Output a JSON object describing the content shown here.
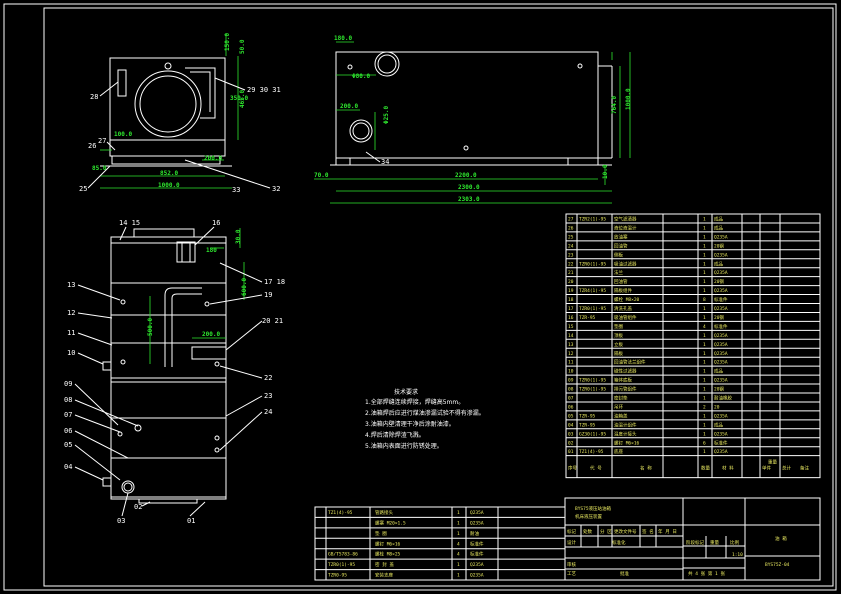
{
  "callouts": {
    "top_left": [
      "28",
      "29 30 31",
      "27",
      "26",
      "25",
      "32",
      "33"
    ],
    "main": [
      "14 15",
      "16",
      "17 18",
      "13",
      "19",
      "12",
      "20 21",
      "11",
      "10",
      "22",
      "09",
      "23",
      "08",
      "07",
      "24",
      "06",
      "05",
      "04",
      "03",
      "02",
      "01"
    ],
    "side": [
      "34"
    ]
  },
  "dimensions": {
    "top_left": [
      "150.0",
      "50.0",
      "465.0",
      "350.0",
      "200.0",
      "100.0",
      "852.0",
      "1000.0",
      "85.0"
    ],
    "side": [
      "180.0",
      "Φ80.0",
      "200.0",
      "Φ25.0",
      "764.0",
      "1000.0",
      "10.0",
      "70.0",
      "2200.0",
      "2300.0",
      "2303.0"
    ],
    "main": [
      "180",
      "30.0",
      "600.0",
      "200.0",
      "500.0"
    ]
  },
  "notes": {
    "title": "技术要求",
    "items": [
      "1.全部焊缝连续焊接，焊缝高5mm。",
      "2.油箱焊后应进行煤油渗漏试验不得有渗漏。",
      "3.油箱内壁清理干净后涂耐油漆。",
      "4.焊后清除焊渣飞溅。",
      "5.油箱内表面进行防锈处理。"
    ]
  },
  "parts_list": {
    "headers": [
      "序号",
      "代 号",
      "名 称",
      "数量",
      "材 料",
      "单件",
      "总计",
      "备注"
    ],
    "header_weight": "重量",
    "rows": [
      [
        "27",
        "TZR2(1)-95",
        "空气滤清器",
        "1",
        "成品",
        ""
      ],
      [
        "26",
        "",
        "液位液温计",
        "1",
        "成品",
        ""
      ],
      [
        "25",
        "",
        "放油塞",
        "1",
        "Q235A",
        ""
      ],
      [
        "24",
        "",
        "回油管",
        "1",
        "20钢",
        ""
      ],
      [
        "23",
        "",
        "侧板",
        "1",
        "Q235A",
        ""
      ],
      [
        "22",
        "TZR0(1)-95",
        "吸油过滤器",
        "1",
        "成品",
        ""
      ],
      [
        "21",
        "",
        "法兰",
        "1",
        "Q235A",
        ""
      ],
      [
        "20",
        "",
        "回油管",
        "1",
        "20钢",
        ""
      ],
      [
        "19",
        "TZR4(1)-95",
        "隔板组件",
        "1",
        "Q235A",
        ""
      ],
      [
        "18",
        "",
        "螺栓 M8×20",
        "8",
        "标准件",
        ""
      ],
      [
        "17",
        "TZR0(1)-95",
        "清洗孔盖",
        "1",
        "Q235A",
        ""
      ],
      [
        "16",
        "TZR-95",
        "吸油管组件",
        "1",
        "20钢",
        ""
      ],
      [
        "15",
        "",
        "垫圈",
        "4",
        "标准件",
        ""
      ],
      [
        "14",
        "",
        "顶板",
        "1",
        "Q235A",
        ""
      ],
      [
        "13",
        "",
        "立板",
        "1",
        "Q235A",
        ""
      ],
      [
        "12",
        "",
        "隔板",
        "1",
        "Q235A",
        ""
      ],
      [
        "11",
        "",
        "回油管法兰组件",
        "1",
        "Q235A",
        ""
      ],
      [
        "10",
        "",
        "磁性过滤器",
        "1",
        "成品",
        ""
      ],
      [
        "09",
        "TZR0(1)-95",
        "箱体底板",
        "1",
        "Q235A",
        ""
      ],
      [
        "08",
        "TZR0(1)-95",
        "排污管组件",
        "1",
        "20钢",
        ""
      ],
      [
        "07",
        "",
        "密封垫",
        "1",
        "耐油橡胶",
        ""
      ],
      [
        "06",
        "",
        "吊环",
        "2",
        "20",
        ""
      ],
      [
        "05",
        "TZR-95",
        "油箱盖",
        "1",
        "Q235A",
        ""
      ],
      [
        "04",
        "TZR-95",
        "油温计组件",
        "1",
        "成品",
        ""
      ],
      [
        "03",
        "GZ30(1)-95",
        "温度计接头",
        "1",
        "Q235A",
        ""
      ],
      [
        "02",
        "",
        "螺钉 M6×16",
        "6",
        "标准件",
        ""
      ],
      [
        "01",
        "TZ1(4)-95",
        "底座",
        "1",
        "Q235A",
        ""
      ]
    ]
  },
  "title_block": {
    "rows": [
      [
        "TZ1(4)-95",
        "管路接头",
        "1",
        "Q235A"
      ],
      [
        "",
        "螺塞 M20×1.5",
        "1",
        "Q235A"
      ],
      [
        "",
        "垫 圈",
        "1",
        "耐油"
      ],
      [
        "",
        "螺钉 M6×16",
        "4",
        "标准件"
      ],
      [
        "GB/T5783-86",
        "螺栓 M8×25",
        "4",
        "标准件"
      ],
      [
        "TZR0(1)-95",
        "密 封 盖",
        "1",
        "Q235A"
      ],
      [
        "TZR0-95",
        "安装支座",
        "1",
        "Q235A"
      ]
    ],
    "product": "BYS75液压站油箱",
    "subtitle": "机床液压装置",
    "drawing_name": "油 箱",
    "drawing_no": "BYS75Z-04",
    "scale": "1:10",
    "sheet": "共 4 张  第 1 张",
    "labels": [
      "标记",
      "处数",
      "分 区",
      "更改文件号",
      "签 名",
      "年 月 日",
      "设计",
      "标准化",
      "阶段标记",
      "重量",
      "比例",
      "审核",
      "工艺",
      "批准"
    ]
  }
}
